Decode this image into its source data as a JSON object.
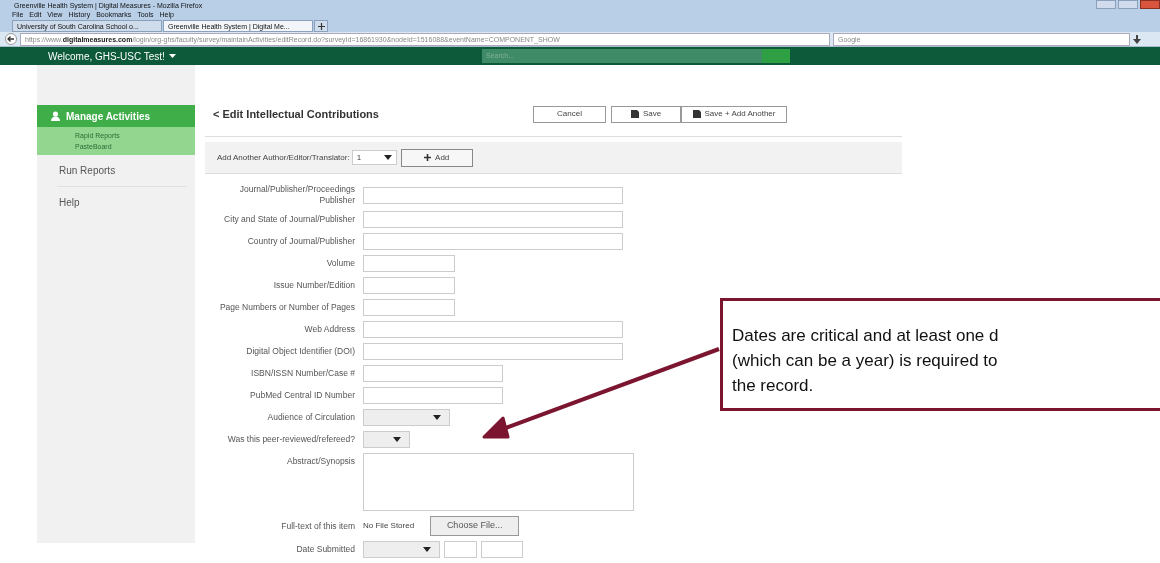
{
  "browser": {
    "title": "Greenville Health System | Digital Measures - Mozilla Firefox",
    "menu": [
      "File",
      "Edit",
      "View",
      "History",
      "Bookmarks",
      "Tools",
      "Help"
    ],
    "tabs": [
      {
        "label": "University of South Carolina School o...",
        "selected": false
      },
      {
        "label": "Greenville Health System | Digital Me...",
        "selected": true
      }
    ],
    "url": {
      "prefix": "https://www.",
      "domain": "digitalmeasures.com",
      "path": "/login/org-ghs/faculty/survey/maintainActivities/editRecord.do?surveyId=16861930&nodeId=1516088&eventName=COMPONENT_SHOW"
    },
    "search_placeholder": "Google"
  },
  "nav": {
    "welcome": "Welcome, GHS-USC Test!",
    "search_placeholder": "Search..."
  },
  "sidebar": {
    "header": "Manage Activities",
    "subitems": [
      "Rapid Reports",
      "PasteBoard"
    ],
    "items": [
      "Run Reports",
      "Help"
    ]
  },
  "form": {
    "back": "<",
    "title": "Edit Intellectual Contributions",
    "buttons": [
      {
        "label": "Cancel",
        "kind": "cancel"
      },
      {
        "label": "Save",
        "kind": "save"
      },
      {
        "label": "Save + Add Another",
        "kind": "save-add"
      }
    ],
    "author_row": {
      "label": "Add Another Author/Editor/Translator:",
      "value": "1",
      "button": "Add"
    },
    "fields": [
      {
        "label": "Journal/Publisher/Proceedings Publisher",
        "kind": "wide"
      },
      {
        "label": "City and State of Journal/Publisher",
        "kind": "wide"
      },
      {
        "label": "Country of Journal/Publisher",
        "kind": "wide"
      },
      {
        "label": "Volume",
        "kind": "short"
      },
      {
        "label": "Issue Number/Edition",
        "kind": "short"
      },
      {
        "label": "Page Numbers or Number of Pages",
        "kind": "short"
      },
      {
        "label": "Web Address",
        "kind": "wide"
      },
      {
        "label": "Digital Object Identifier (DOI)",
        "kind": "wide"
      },
      {
        "label": "ISBN/ISSN Number/Case #",
        "kind": "medium"
      },
      {
        "label": "PubMed Central ID Number",
        "kind": "medium"
      },
      {
        "label": "Audience of Circulation",
        "kind": "dropdown"
      },
      {
        "label": "Was this peer-reviewed/refereed?",
        "kind": "toggle"
      },
      {
        "label": "Abstract/Synopsis",
        "kind": "textarea"
      },
      {
        "label": "Full-text of this item",
        "kind": "file",
        "status": "No File Stored",
        "button": "Choose File..."
      },
      {
        "label": "Date Submitted",
        "kind": "date"
      }
    ]
  },
  "callout": {
    "lines": [
      "Dates are critical and at least one d",
      "(which can be a year) is required to",
      "the record."
    ]
  }
}
